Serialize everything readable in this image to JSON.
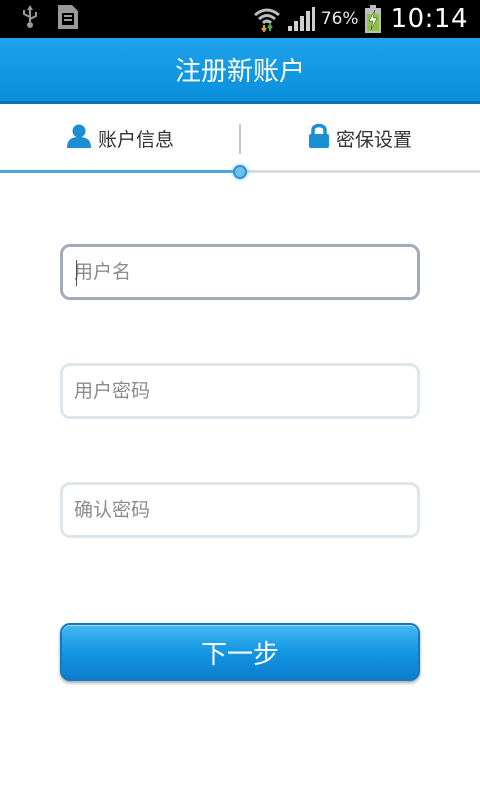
{
  "status_bar": {
    "icons": [
      "usb-icon",
      "sd-card-icon",
      "wifi-icon",
      "signal-icon",
      "battery-charging-icon"
    ],
    "battery_percent": "76%",
    "time": "10:14"
  },
  "header": {
    "title": "注册新账户"
  },
  "steps": {
    "items": [
      {
        "label": "账户信息",
        "icon": "user-icon"
      },
      {
        "label": "密保设置",
        "icon": "lock-icon"
      }
    ],
    "progress": 0.5
  },
  "form": {
    "username": {
      "placeholder": "用户名",
      "value": ""
    },
    "password": {
      "placeholder": "用户密码",
      "value": ""
    },
    "confirm_password": {
      "placeholder": "确认密码",
      "value": ""
    }
  },
  "actions": {
    "next_label": "下一步"
  },
  "colors": {
    "accent": "#0a8fdd",
    "status_bar": "#000000",
    "field_border": "#dde6ec",
    "field_border_focused": "#9fadba"
  }
}
